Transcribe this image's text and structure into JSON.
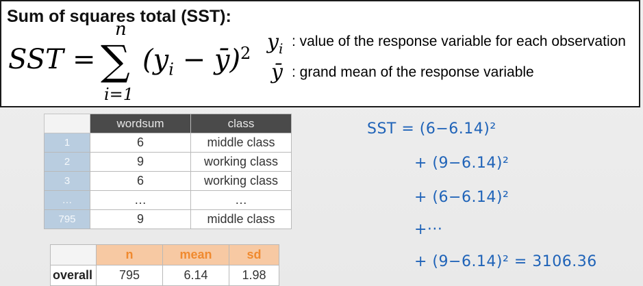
{
  "formula_box": {
    "title": "Sum of squares total (SST):",
    "lhs": "SST",
    "equals": "=",
    "sigma": "∑",
    "upper_limit": "n",
    "lower_limit": "i=1",
    "body": "(y",
    "body_sub": "i",
    "body_minus": "− ȳ)",
    "exponent": "2",
    "definitions": [
      {
        "symbol": "y",
        "symbol_sub": "i",
        "text": ": value of the response variable for each observation"
      },
      {
        "symbol": "ȳ",
        "symbol_sub": "",
        "text": ": grand mean of the response variable"
      }
    ]
  },
  "data_table": {
    "headers": [
      "",
      "wordsum",
      "class"
    ],
    "rows": [
      {
        "index": "1",
        "wordsum": "6",
        "class": "middle class"
      },
      {
        "index": "2",
        "wordsum": "9",
        "class": "working class"
      },
      {
        "index": "3",
        "wordsum": "6",
        "class": "working class"
      },
      {
        "index": "…",
        "wordsum": "…",
        "class": "…"
      },
      {
        "index": "795",
        "wordsum": "9",
        "class": "middle class"
      }
    ]
  },
  "summary_table": {
    "headers": [
      "",
      "n",
      "mean",
      "sd"
    ],
    "row": {
      "label": "overall",
      "n": "795",
      "mean": "6.14",
      "sd": "1.98"
    }
  },
  "handwriting": {
    "lines": [
      "SST = (6−6.14)²",
      "+ (9−6.14)²",
      "+ (6−6.14)²",
      "+···",
      "+ (9−6.14)² = 3106.36"
    ],
    "color": "#1f63b8"
  },
  "colors": {
    "table_header_dark": "#4a4a4a",
    "index_column": "#b9cde0",
    "summary_header_bg": "#f7c9a3",
    "summary_header_text": "#f08a2f",
    "ink_blue": "#1f63b8"
  }
}
